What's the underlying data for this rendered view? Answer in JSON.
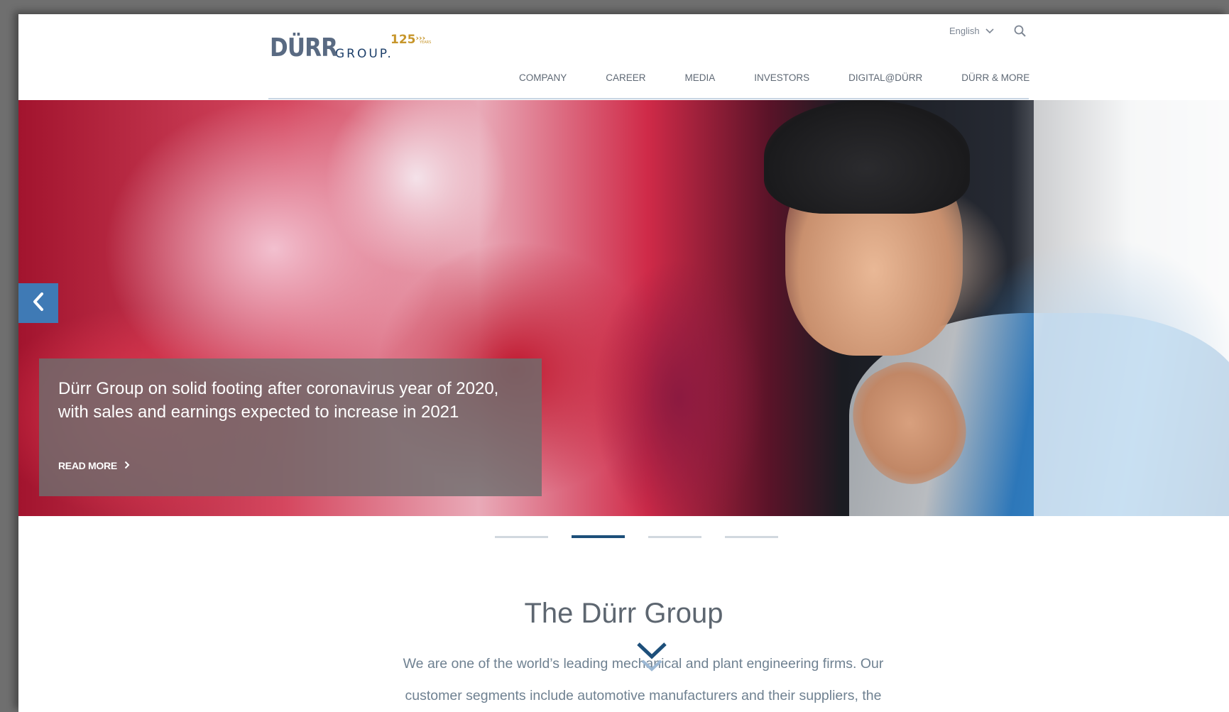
{
  "header": {
    "logo": {
      "main": "DÜRR",
      "sub": "GROUP.",
      "anniversary": "125",
      "anniversary_small": "YEARS"
    },
    "language": "English",
    "nav": [
      "COMPANY",
      "CAREER",
      "MEDIA",
      "INVESTORS",
      "DIGITAL@DÜRR",
      "DÜRR & MORE"
    ]
  },
  "hero": {
    "caption_title": "Dürr Group on solid footing after coronavirus year of 2020, with sales and earnings expected to increase in 2021",
    "read_more": "READ MORE",
    "slides_count": 4,
    "active_slide": 2
  },
  "about": {
    "title": "The Dürr Group",
    "text": "We are one of the world’s leading mechanical and plant engineering firms. Our customer segments include automotive manufacturers and their suppliers, the"
  },
  "colors": {
    "accent": "#3f7ab5",
    "nav_text": "#5f6975",
    "dot_active": "#1d4f7a",
    "dot_inactive": "#d1d8df",
    "logo_gold": "#c7962b"
  },
  "icons": [
    "chevron-down-icon",
    "search-icon",
    "chevron-left-icon",
    "chevron-right-icon",
    "scroll-down-icon"
  ]
}
